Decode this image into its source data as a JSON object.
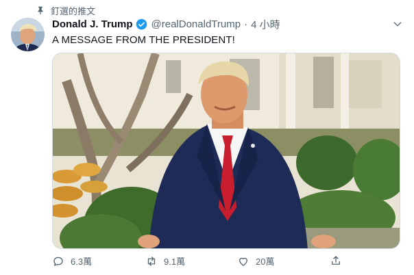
{
  "pinned": {
    "label": "釘選的推文",
    "icon": "pin-icon"
  },
  "author": {
    "display_name": "Donald J. Trump",
    "verified": true,
    "handle": "@realDonaldTrump",
    "separator": "·",
    "timestamp": "4 小時"
  },
  "tweet": {
    "text": "A MESSAGE FROM THE PRESIDENT!"
  },
  "media": {
    "type": "video-thumbnail"
  },
  "actions": {
    "reply_count": "6.3萬",
    "retweet_count": "9.1萬",
    "like_count": "20萬"
  },
  "colors": {
    "verified_blue": "#1d9bf0",
    "secondary_text": "#536471"
  }
}
